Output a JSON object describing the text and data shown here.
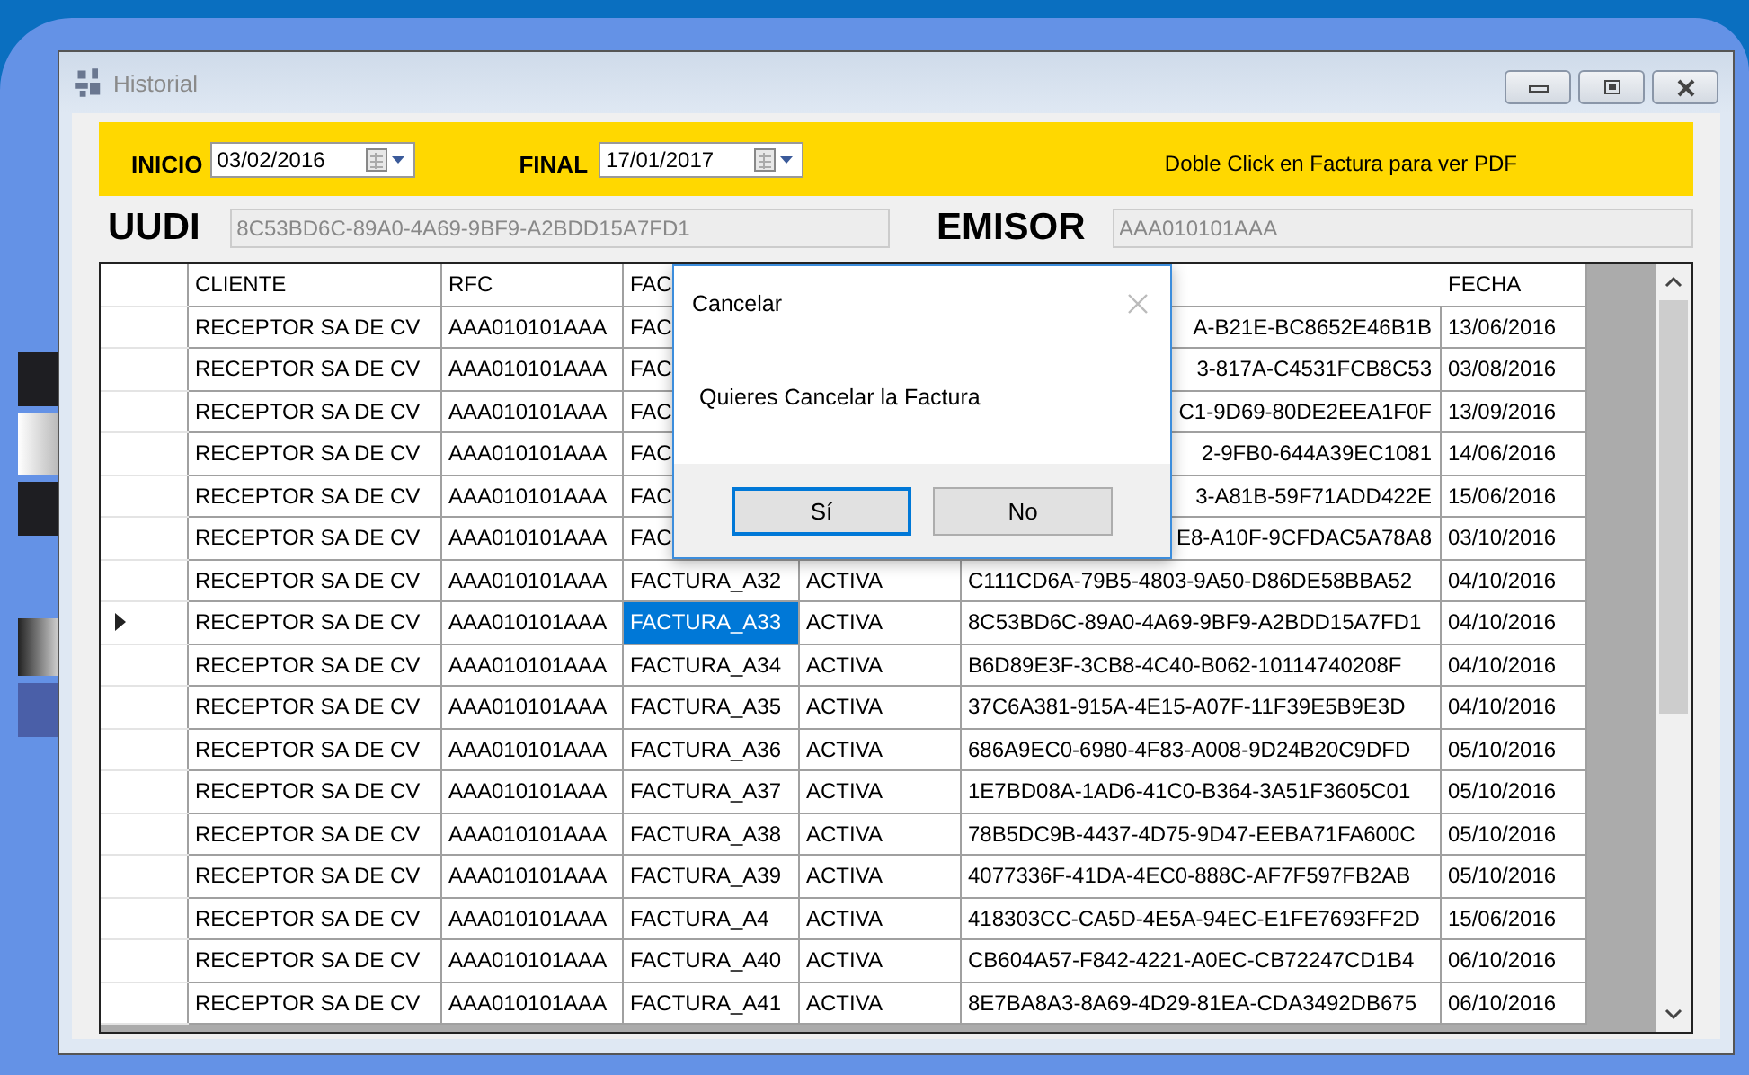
{
  "window": {
    "title": "Historial"
  },
  "filters": {
    "start_label": "INICIO",
    "start_date": "03/02/2016",
    "end_label": "FINAL",
    "end_date": "17/01/2017",
    "hint": "Doble Click en Factura  para ver PDF"
  },
  "uudi": {
    "label": "UUDI",
    "value": "8C53BD6C-89A0-4A69-9BF9-A2BDD15A7FD1"
  },
  "emisor": {
    "label": "EMISOR",
    "value": "AAA010101AAA"
  },
  "table": {
    "columns": [
      "CLIENTE",
      "RFC",
      "FAC",
      "FECHA"
    ],
    "rows": [
      {
        "cliente": "RECEPTOR SA DE CV",
        "rfc": "AAA010101AAA",
        "factura": "FAC",
        "uuid": "A-B21E-BC8652E46B1B",
        "fecha": "13/06/2016",
        "selected": false
      },
      {
        "cliente": "RECEPTOR SA DE CV",
        "rfc": "AAA010101AAA",
        "factura": "FAC",
        "uuid": "3-817A-C4531FCB8C53",
        "fecha": "03/08/2016",
        "selected": false
      },
      {
        "cliente": "RECEPTOR SA DE CV",
        "rfc": "AAA010101AAA",
        "factura": "FAC",
        "uuid": "C1-9D69-80DE2EEA1F0F",
        "fecha": "13/09/2016",
        "selected": false
      },
      {
        "cliente": "RECEPTOR SA DE CV",
        "rfc": "AAA010101AAA",
        "factura": "FAC",
        "uuid": "2-9FB0-644A39EC1081",
        "fecha": "14/06/2016",
        "selected": false
      },
      {
        "cliente": "RECEPTOR SA DE CV",
        "rfc": "AAA010101AAA",
        "factura": "FAC",
        "uuid": "3-A81B-59F71ADD422E",
        "fecha": "15/06/2016",
        "selected": false
      },
      {
        "cliente": "RECEPTOR SA DE CV",
        "rfc": "AAA010101AAA",
        "factura": "FAC",
        "uuid": "E8-A10F-9CFDAC5A78A8",
        "fecha": "03/10/2016",
        "selected": false
      },
      {
        "cliente": "RECEPTOR SA DE CV",
        "rfc": "AAA010101AAA",
        "factura": "FACTURA_A32",
        "estado": "ACTIVA",
        "uuid": "C111CD6A-79B5-4803-9A50-D86DE58BBA52",
        "fecha": "04/10/2016",
        "selected": false
      },
      {
        "cliente": "RECEPTOR SA DE CV",
        "rfc": "AAA010101AAA",
        "factura": "FACTURA_A33",
        "estado": "ACTIVA",
        "uuid": "8C53BD6C-89A0-4A69-9BF9-A2BDD15A7FD1",
        "fecha": "04/10/2016",
        "selected": true
      },
      {
        "cliente": "RECEPTOR SA DE CV",
        "rfc": "AAA010101AAA",
        "factura": "FACTURA_A34",
        "estado": "ACTIVA",
        "uuid": "B6D89E3F-3CB8-4C40-B062-10114740208F",
        "fecha": "04/10/2016",
        "selected": false
      },
      {
        "cliente": "RECEPTOR SA DE CV",
        "rfc": "AAA010101AAA",
        "factura": "FACTURA_A35",
        "estado": "ACTIVA",
        "uuid": "37C6A381-915A-4E15-A07F-11F39E5B9E3D",
        "fecha": "04/10/2016",
        "selected": false
      },
      {
        "cliente": "RECEPTOR SA DE CV",
        "rfc": "AAA010101AAA",
        "factura": "FACTURA_A36",
        "estado": "ACTIVA",
        "uuid": "686A9EC0-6980-4F83-A008-9D24B20C9DFD",
        "fecha": "05/10/2016",
        "selected": false
      },
      {
        "cliente": "RECEPTOR SA DE CV",
        "rfc": "AAA010101AAA",
        "factura": "FACTURA_A37",
        "estado": "ACTIVA",
        "uuid": "1E7BD08A-1AD6-41C0-B364-3A51F3605C01",
        "fecha": "05/10/2016",
        "selected": false
      },
      {
        "cliente": "RECEPTOR SA DE CV",
        "rfc": "AAA010101AAA",
        "factura": "FACTURA_A38",
        "estado": "ACTIVA",
        "uuid": "78B5DC9B-4437-4D75-9D47-EEBA71FA600C",
        "fecha": "05/10/2016",
        "selected": false
      },
      {
        "cliente": "RECEPTOR SA DE CV",
        "rfc": "AAA010101AAA",
        "factura": "FACTURA_A39",
        "estado": "ACTIVA",
        "uuid": "4077336F-41DA-4EC0-888C-AF7F597FB2AB",
        "fecha": "05/10/2016",
        "selected": false
      },
      {
        "cliente": "RECEPTOR SA DE CV",
        "rfc": "AAA010101AAA",
        "factura": "FACTURA_A4",
        "estado": "ACTIVA",
        "uuid": "418303CC-CA5D-4E5A-94EC-E1FE7693FF2D",
        "fecha": "15/06/2016",
        "selected": false
      },
      {
        "cliente": "RECEPTOR SA DE CV",
        "rfc": "AAA010101AAA",
        "factura": "FACTURA_A40",
        "estado": "ACTIVA",
        "uuid": "CB604A57-F842-4221-A0EC-CB72247CD1B4",
        "fecha": "06/10/2016",
        "selected": false
      },
      {
        "cliente": "RECEPTOR SA DE CV",
        "rfc": "AAA010101AAA",
        "factura": "FACTURA_A41",
        "estado": "ACTIVA",
        "uuid": "8E7BA8A3-8A69-4D29-81EA-CDA3492DB675",
        "fecha": "06/10/2016",
        "selected": false
      }
    ]
  },
  "dialog": {
    "title": "Cancelar",
    "message": "Quieres Cancelar la Factura",
    "buttons": [
      {
        "label": "Sí",
        "default": true
      },
      {
        "label": "No",
        "default": false
      }
    ]
  }
}
